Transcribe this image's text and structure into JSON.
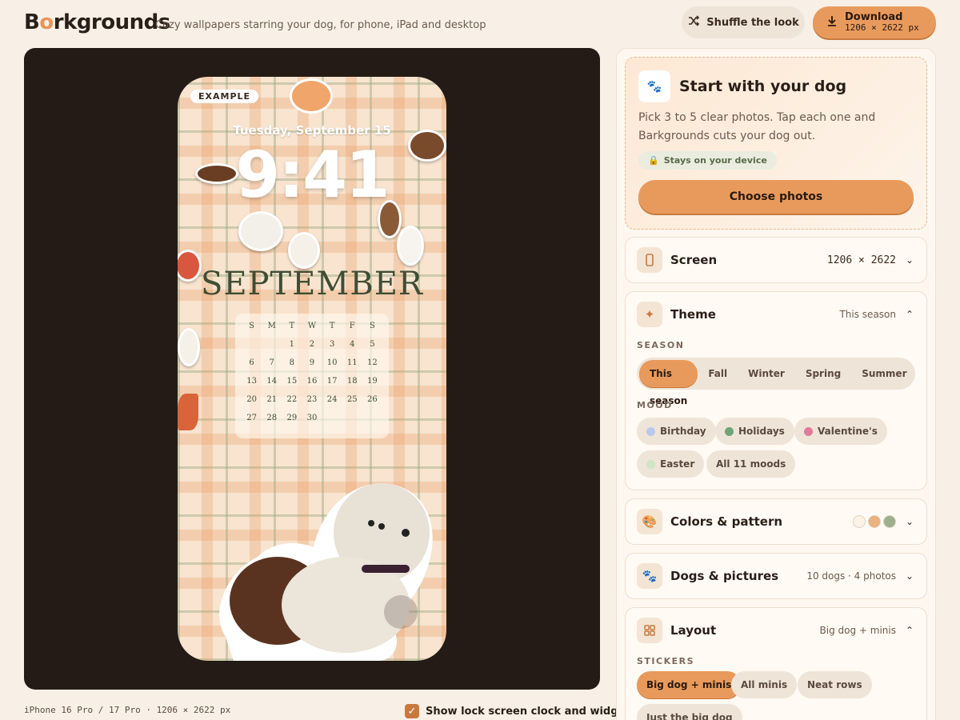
{
  "header": {
    "logo_pre": "B",
    "logo_o": "o",
    "logo_post": "rkgrounds",
    "tagline": "Cozy wallpapers starring your dog, for phone, iPad and desktop",
    "shuffle_label": "Shuffle the look",
    "download_label": "Download",
    "download_size": "1206 × 2622 px"
  },
  "preview": {
    "badge": "EXAMPLE",
    "date": "Tuesday, September 15",
    "time": "9:41",
    "month": "SEPTEMBER",
    "weekdays": [
      "S",
      "M",
      "T",
      "W",
      "T",
      "F",
      "S"
    ],
    "days": [
      "",
      "",
      "1",
      "2",
      "3",
      "4",
      "5",
      "6",
      "7",
      "8",
      "9",
      "10",
      "11",
      "12",
      "13",
      "14",
      "15",
      "16",
      "17",
      "18",
      "19",
      "20",
      "21",
      "22",
      "23",
      "24",
      "25",
      "26",
      "27",
      "28",
      "29",
      "30",
      "",
      "",
      ""
    ],
    "caption": "iPhone 16 Pro / 17 Pro · 1206 × 2622 px",
    "clock_toggle_label": "Show lock screen clock and widgets",
    "clock_toggle_checked": true
  },
  "start": {
    "title": "Start with your dog",
    "description": "Pick 3 to 5 clear photos. Tap each one and Barkgrounds cuts your dog out.",
    "privacy_pill": "Stays on your device",
    "choose_label": "Choose photos"
  },
  "screen": {
    "title": "Screen",
    "value": "1206 × 2622"
  },
  "theme": {
    "title": "Theme",
    "value": "This season",
    "season_label": "SEASON",
    "seasons": [
      "This season",
      "Fall",
      "Winter",
      "Spring",
      "Summer"
    ],
    "season_selected": "This season",
    "mood_label": "MOOD",
    "moods": [
      {
        "label": "Birthday",
        "color": "#b9c9ec"
      },
      {
        "label": "Holidays",
        "color": "#6fa57a"
      },
      {
        "label": "Valentine's",
        "color": "#e07a9a"
      },
      {
        "label": "Easter",
        "color": "#cfe5c6"
      },
      {
        "label": "All 11 moods",
        "color": ""
      }
    ]
  },
  "colors": {
    "title": "Colors & pattern",
    "swatches": [
      "#fbf3e8",
      "#e9b27e",
      "#9bb08c"
    ]
  },
  "dogs": {
    "title": "Dogs & pictures",
    "value": "10 dogs · 4 photos"
  },
  "layout": {
    "title": "Layout",
    "value": "Big dog + minis",
    "stickers_label": "STICKERS",
    "options": [
      "Big dog + minis",
      "All minis",
      "Neat rows",
      "Just the big dog"
    ],
    "selected": "Big dog + minis"
  },
  "colors_ui": {
    "accent": "#e89a5c",
    "stage_bg": "#241b16",
    "page_bg": "#f8f0e6"
  }
}
